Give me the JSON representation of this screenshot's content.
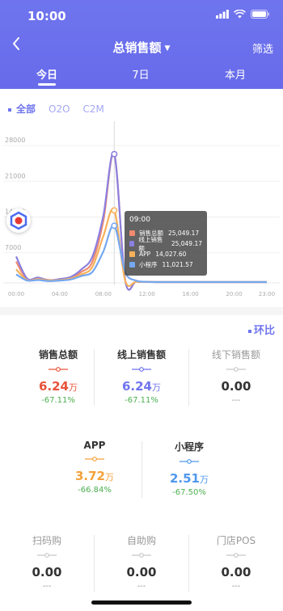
{
  "status": {
    "time": "10:00"
  },
  "nav": {
    "title": "总销售额",
    "filter_label": "筛选"
  },
  "tabs": [
    {
      "label": "今日",
      "active": true
    },
    {
      "label": "7日",
      "active": false
    },
    {
      "label": "本月",
      "active": false
    }
  ],
  "channel_filters": [
    {
      "label": "全部",
      "active": true
    },
    {
      "label": "O2O",
      "active": false
    },
    {
      "label": "C2M",
      "active": false
    }
  ],
  "chart_data": {
    "type": "line",
    "x_tick_labels": [
      "00:00",
      "04:00",
      "08:00",
      "12:00",
      "16:00",
      "20:00",
      "23:00"
    ],
    "y_tick_labels": [
      "28000",
      "21000",
      "14000",
      "7000"
    ],
    "ylim": [
      0,
      28000
    ],
    "x_hours": [
      0,
      1,
      2,
      3,
      4,
      5,
      6,
      7,
      8,
      9,
      10,
      11,
      12,
      13,
      14,
      15,
      16,
      17,
      18,
      19,
      20,
      21,
      22,
      23
    ],
    "series": [
      {
        "name": "销售总额",
        "color": "#f08a6f",
        "values": [
          4000,
          500,
          800,
          400,
          500,
          900,
          2000,
          4000,
          12000,
          25049.17,
          400,
          100,
          50,
          0,
          0,
          0,
          0,
          0,
          0,
          0,
          0,
          0,
          0,
          0
        ]
      },
      {
        "name": "线上销售额",
        "color": "#8b7fe0",
        "values": [
          5000,
          700,
          900,
          300,
          600,
          1000,
          2500,
          5000,
          13000,
          25049.17,
          400,
          100,
          50,
          0,
          0,
          0,
          0,
          0,
          0,
          0,
          0,
          0,
          0,
          0
        ]
      },
      {
        "name": "APP",
        "color": "#f6b15a",
        "values": [
          2500,
          400,
          600,
          300,
          400,
          700,
          1500,
          3000,
          9000,
          14027.6,
          300,
          80,
          30,
          0,
          0,
          0,
          0,
          0,
          0,
          0,
          0,
          0,
          0,
          0
        ]
      },
      {
        "name": "小程序",
        "color": "#74a7f0",
        "values": [
          1500,
          300,
          400,
          200,
          300,
          500,
          1200,
          2000,
          6000,
          11021.57,
          2000,
          300,
          50,
          0,
          0,
          0,
          0,
          0,
          0,
          0,
          0,
          0,
          0,
          0
        ]
      }
    ],
    "selected_hour": 9,
    "tooltip": {
      "title": "09:00",
      "rows": [
        {
          "label": "销售总额",
          "value": "25,049.17",
          "color": "#f08a6f"
        },
        {
          "label": "线上销售额",
          "value": "25,049.17",
          "color": "#8b7fe0"
        },
        {
          "label": "APP",
          "value": "14,027.60",
          "color": "#f6b15a"
        },
        {
          "label": "小程序",
          "value": "11,021.57",
          "color": "#74a7f0"
        }
      ]
    }
  },
  "compare_label": "环比",
  "metrics": [
    {
      "name": "销售总额",
      "value": "6.24",
      "unit": "万",
      "change": "-67.11%",
      "color": "#e8533a",
      "dim": false
    },
    {
      "name": "线上销售额",
      "value": "6.24",
      "unit": "万",
      "change": "-67.11%",
      "color": "#6f74ee",
      "dim": false
    },
    {
      "name": "线下销售额",
      "value": "0.00",
      "unit": "",
      "change": "---",
      "color": "#999999",
      "dim": true
    },
    {
      "name": "APP",
      "value": "3.72",
      "unit": "万",
      "change": "-66.84%",
      "color": "#f4a13a",
      "dim": false
    },
    {
      "name": "小程序",
      "value": "2.51",
      "unit": "万",
      "change": "-67.50%",
      "color": "#4f97ee",
      "dim": false
    },
    {
      "name": "扫码购",
      "value": "0.00",
      "unit": "",
      "change": "---",
      "color": "#999999",
      "dim": true
    },
    {
      "name": "自助购",
      "value": "0.00",
      "unit": "",
      "change": "---",
      "color": "#999999",
      "dim": true
    },
    {
      "name": "门店POS",
      "value": "0.00",
      "unit": "",
      "change": "---",
      "color": "#999999",
      "dim": true
    }
  ]
}
